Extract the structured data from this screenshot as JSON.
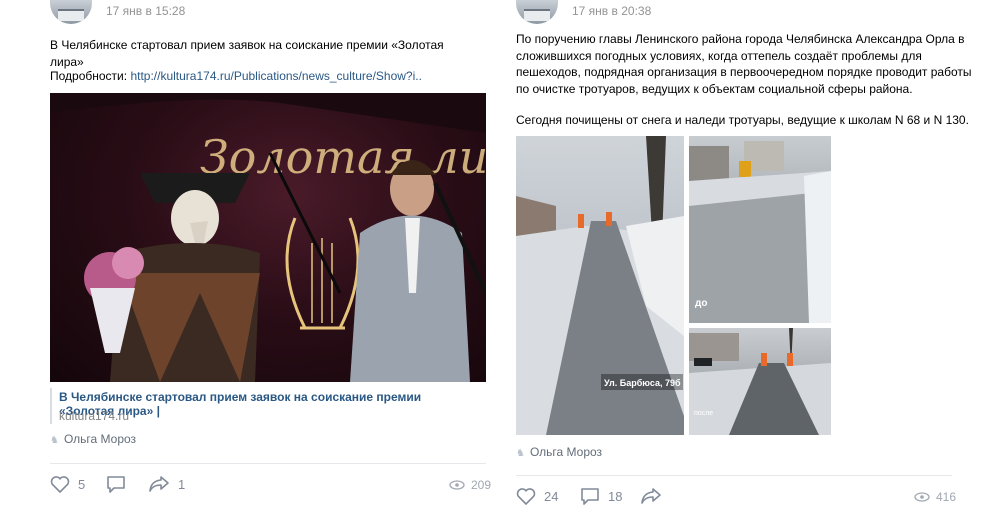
{
  "left_post": {
    "date": "17 янв в 15:28",
    "text": "В Челябинске стартовал прием заявок на соискание премии «Золотая лира»",
    "details_label": "Подробности:",
    "details_link": "http://kultura174.ru/Publications/news_culture/Show?i..",
    "photo_sign_text": "Золотая лира",
    "snippet_title": "В Челябинске стартовал прием заявок на соискание премии «Золотая лира» |",
    "snippet_domain": "kultura174.ru",
    "author": "Ольга Мороз",
    "likes": "5",
    "shares": "1",
    "views": "209"
  },
  "right_post": {
    "date": "17 янв в 20:38",
    "text_lines": [
      "По поручению главы Ленинского района города Челябинска Александра Орла в",
      "сложившихся погодных условиях, когда оттепель создаёт проблемы для",
      "пешеходов, подрядная организация в первоочередном порядке проводит работы",
      "по очистке тротуаров, ведущих к объектам социальной сферы района."
    ],
    "text2": "Сегодня почищены от снега и наледи тротуары, ведущие к школам N 68 и N 130.",
    "photo1_caption": "Ул. Барбюса, 79б",
    "photo2_caption": "до",
    "photo3_caption": "после",
    "author": "Ольга Мороз",
    "likes": "24",
    "comments": "18",
    "views": "416"
  },
  "colors": {
    "link": "#2a5885",
    "meta": "#939393",
    "action": "#828a99"
  }
}
